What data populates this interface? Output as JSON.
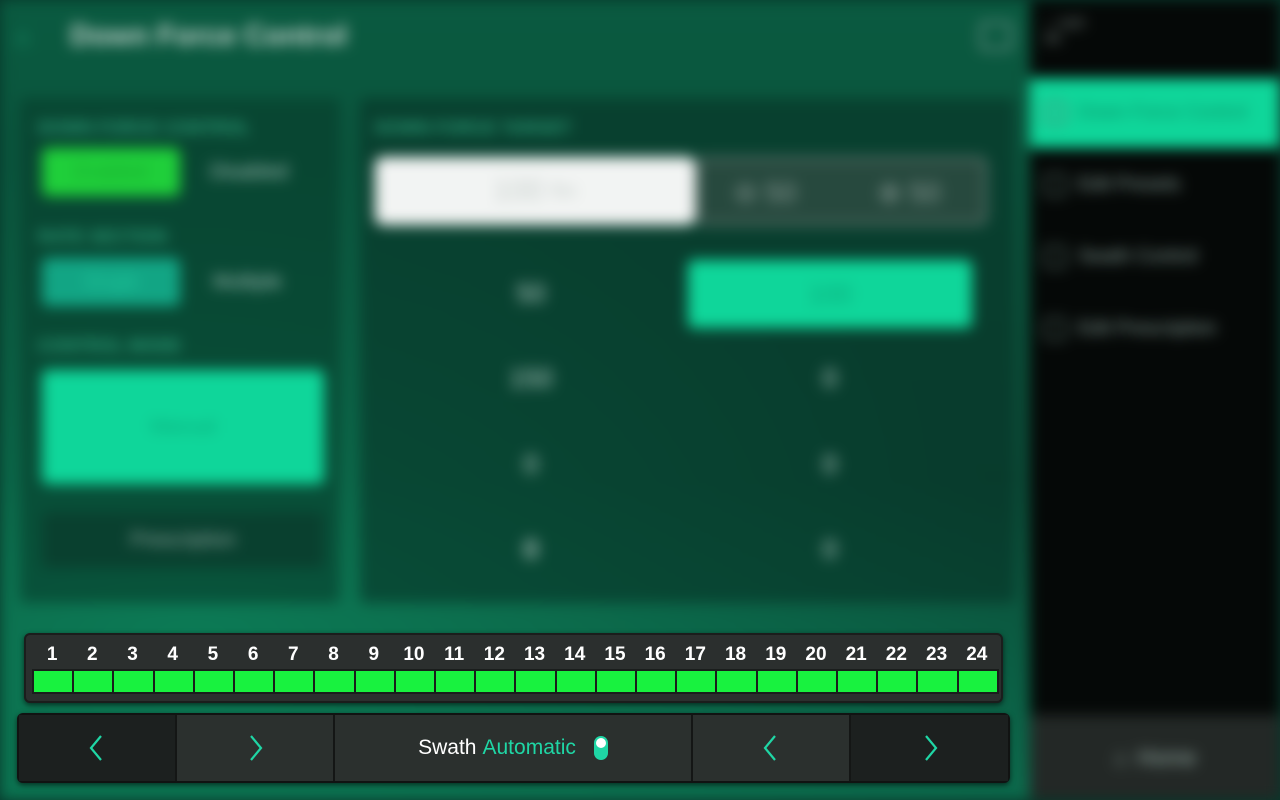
{
  "header": {
    "title": "Down Force Control"
  },
  "status": {
    "speed_value": "--",
    "speed_unit": "mph",
    "signal_bars": "lllll"
  },
  "down_force_control": {
    "label": "DOWN FORCE CONTROL",
    "enabled_label": "Enabled",
    "disabled_label": "Disabled",
    "selected": "Enabled"
  },
  "rate_section": {
    "label": "RATE SECTION",
    "single_label": "Single",
    "multiple_label": "Multiple",
    "selected": "Single"
  },
  "control_mode": {
    "label": "CONTROL MODE",
    "manual_label": "Manual",
    "prescription_label": "Prescription",
    "selected": "Manual"
  },
  "target": {
    "label": "DOWN FORCE TARGET",
    "value": "100",
    "unit": "lbs",
    "decrement": "50",
    "increment": "50"
  },
  "presets": {
    "left_column": [
      "50",
      "150",
      "0",
      "0"
    ],
    "right_column": [
      "100",
      "0",
      "0",
      "0"
    ],
    "selected_value": "100"
  },
  "sidebar": {
    "items": [
      {
        "label": "Down Force Control",
        "active": true
      },
      {
        "label": "Edit Presets",
        "active": false
      },
      {
        "label": "Swath Control",
        "active": false
      },
      {
        "label": "Edit Prescription",
        "active": false
      }
    ],
    "home_label": "Home"
  },
  "swath": {
    "sections": [
      "1",
      "2",
      "3",
      "4",
      "5",
      "6",
      "7",
      "8",
      "9",
      "10",
      "11",
      "12",
      "13",
      "14",
      "15",
      "16",
      "17",
      "18",
      "19",
      "20",
      "21",
      "22",
      "23",
      "24"
    ],
    "section_color": "#18f23f",
    "label": "Swath",
    "mode": "Automatic",
    "accent_color": "#1fd6a5"
  }
}
